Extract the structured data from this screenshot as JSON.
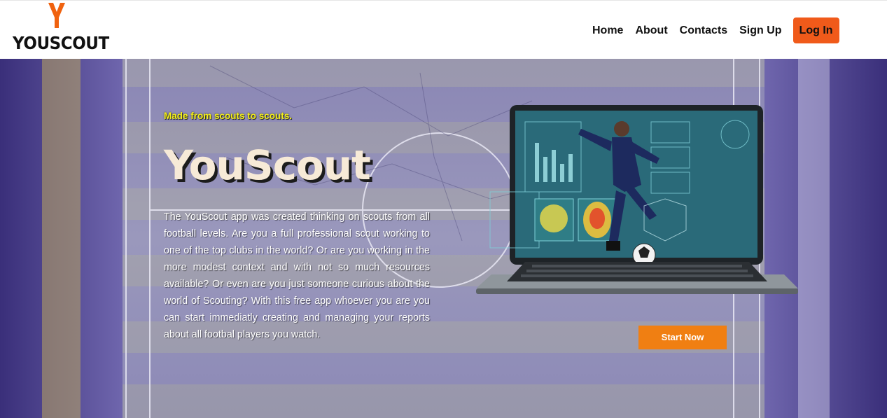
{
  "brand": {
    "name": "YOUSCOUT",
    "accent_color": "#f0620f"
  },
  "nav": {
    "items": [
      {
        "label": "Home"
      },
      {
        "label": "About"
      },
      {
        "label": "Contacts"
      },
      {
        "label": "Sign Up"
      }
    ],
    "login_label": "Log In",
    "login_color": "#f05a1a"
  },
  "hero": {
    "tagline": "Made from scouts to scouts.",
    "title": "YouScout",
    "description": "The YouScout app was created thinking on scouts from all football levels. Are you a full professional scout working to one of the top clubs in the world? Or are you working in the more modest context and with not so much resources available? Or even are you just someone curious about the world of Scouting? With this free app whoever you are you can start immediatly creating and managing your reports about all footbal players you watch.",
    "cta_label": "Start Now",
    "cta_color": "#f07f12",
    "background_color": "#6d66a8"
  }
}
